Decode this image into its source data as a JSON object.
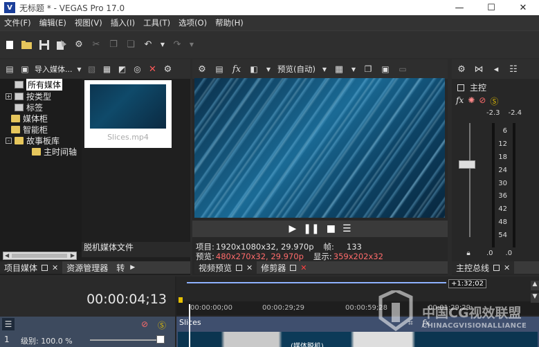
{
  "titlebar": {
    "logo": "V",
    "title": "无标题 * - VEGAS Pro 17.0",
    "buttons": [
      "—",
      "☐",
      "✕"
    ]
  },
  "menu": [
    "文件(F)",
    "编辑(E)",
    "视图(V)",
    "插入(I)",
    "工具(T)",
    "选项(O)",
    "帮助(H)"
  ],
  "toolbar": {
    "icons": [
      "new-icon",
      "open-icon",
      "save-icon",
      "render-icon",
      "gear-icon",
      "cut-icon",
      "copy-icon",
      "paste-icon",
      "undo-icon",
      "redo-icon"
    ]
  },
  "project_media": {
    "import_label": "导入媒体...",
    "tree": [
      {
        "label": "所有媒体",
        "selected": true,
        "icon": "media"
      },
      {
        "label": "按类型",
        "selected": false,
        "icon": "media",
        "expander": "+"
      },
      {
        "label": "标签",
        "selected": false,
        "icon": "media"
      },
      {
        "label": "媒体柜",
        "selected": false,
        "icon": "folder"
      },
      {
        "label": "智能柜",
        "selected": false,
        "icon": "folder"
      },
      {
        "label": "故事板库",
        "selected": false,
        "icon": "folder",
        "expander": "-"
      },
      {
        "label": "主时间轴",
        "selected": false,
        "icon": "folder"
      }
    ],
    "media_item": "Slices.mp4",
    "offline_label": "脱机媒体文件",
    "tabs": [
      {
        "label": "项目媒体"
      },
      {
        "label": "资源管理器"
      },
      {
        "label": "转"
      }
    ]
  },
  "preview": {
    "mode_label": "预览(自动)",
    "info": {
      "project_key": "项目:",
      "project_val": "1920x1080x32, 29.970p",
      "preview_key": "预览:",
      "preview_val": "480x270x32, 29.970p",
      "frame_key": "帧:",
      "frame_val": "133",
      "display_key": "显示:",
      "display_val": "359x202x32"
    },
    "tabs": [
      {
        "label": "视频预览"
      },
      {
        "label": "修剪器"
      }
    ]
  },
  "master": {
    "title": "主控",
    "levels": [
      "-2.3",
      "-2.4"
    ],
    "scale": [
      "6",
      "12",
      "18",
      "24",
      "30",
      "36",
      "42",
      "48",
      "54"
    ],
    "bottom": [
      ".0",
      ".0"
    ],
    "tab": "主控总线"
  },
  "timeline": {
    "time": "00:00:04;13",
    "end_time": "+1:32;02",
    "ruler": [
      "00:00:00;00",
      "00:00:29;29",
      "00:00:59;28",
      "00:01:29;29"
    ],
    "track": {
      "level": "级别: 100.0 %",
      "number": "1"
    },
    "clip_name": "Slices",
    "clip_offline": "(媒体脱机)"
  },
  "watermark": {
    "big": "中国CG视效联盟",
    "small": "CHINACGVISIONALLIANCE"
  }
}
